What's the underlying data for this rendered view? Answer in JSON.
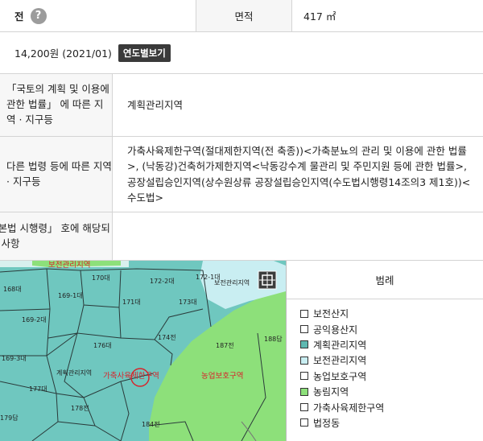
{
  "row1": {
    "left_text": "전",
    "help_icon": "?",
    "area_label": "면적",
    "area_value": "417 ㎡"
  },
  "row2": {
    "price": "14,200원 (2021/01)",
    "yearly_button": "연도별보기"
  },
  "row3": {
    "label": "「국토의 계획 및 이용에 관한 법률」 에 따른 지역 · 지구등",
    "value": "계획관리지역"
  },
  "row4": {
    "label": "다른 법령 등에 따른 지역 · 지구등",
    "value": "가축사육제한구역(절대제한지역(전 축종))<가축분뇨의 관리 및 이용에 관한 법률>, (낙동강)건축허가제한지역<낙동강수계 물관리 및 주민지원 등에 관한 법률>, 공장설립승인지역(상수원상류 공장설립승인지역(수도법시행령14조의3 제1호))<수도법>"
  },
  "row5": {
    "label": "기본법 시행령」 호에 해당되는 사항",
    "value": ""
  },
  "map": {
    "parcels": [
      "168대",
      "170대",
      "172-2대",
      "172-1대",
      "169-1대",
      "171대",
      "173대",
      "169-2대",
      "174전",
      "176대",
      "187전",
      "188답",
      "169-3대",
      "177대",
      "179답",
      "178전",
      "184전"
    ],
    "red_labels": [
      "보전관리지역",
      "가축사육제한구역",
      "농업보호구역"
    ],
    "black_labels": [
      "계획관리지역"
    ],
    "top_right_label": "보전관리지역"
  },
  "legend": {
    "title": "범례",
    "items": [
      {
        "label": "보전산지",
        "color": "#ffffff"
      },
      {
        "label": "공익용산지",
        "color": "#ffffff"
      },
      {
        "label": "계획관리지역",
        "color": "#5fb8b1"
      },
      {
        "label": "보전관리지역",
        "color": "#c9eef2"
      },
      {
        "label": "농업보호구역",
        "color": "#ffffff"
      },
      {
        "label": "농림지역",
        "color": "#8de07a"
      },
      {
        "label": "가축사육제한구역",
        "color": "#ffffff"
      },
      {
        "label": "법정동",
        "color": "#ffffff"
      }
    ]
  }
}
